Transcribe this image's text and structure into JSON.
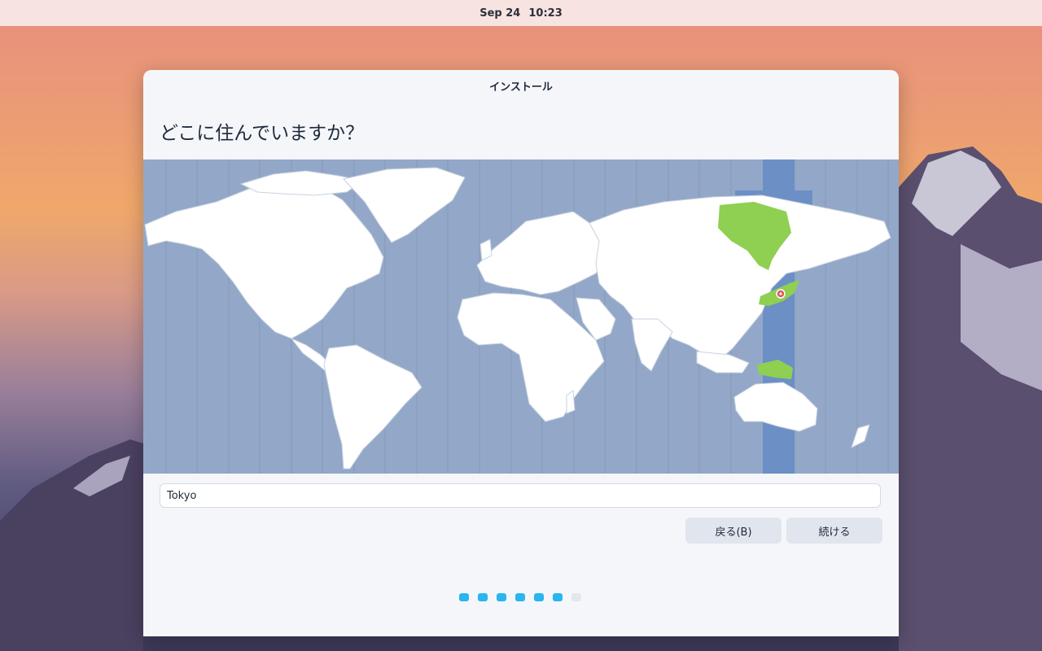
{
  "topbar": {
    "date": "Sep 24",
    "time": "10:23"
  },
  "window": {
    "title": "インストール"
  },
  "page": {
    "heading": "どこに住んでいますか？"
  },
  "map": {
    "selected_timezone": "Tokyo",
    "highlight_color": "#8fcf52",
    "band_color": "#6c8fc6",
    "ocean_color": "#93a8c8",
    "land_color": "#ffffff",
    "pin_icon": "location-pin-icon"
  },
  "timezone_field": {
    "value": "Tokyo"
  },
  "buttons": {
    "back": "戻る(B)",
    "next": "続ける"
  },
  "progress": {
    "total_steps": 7,
    "completed_steps": 6,
    "accent": "#29b5ee"
  }
}
